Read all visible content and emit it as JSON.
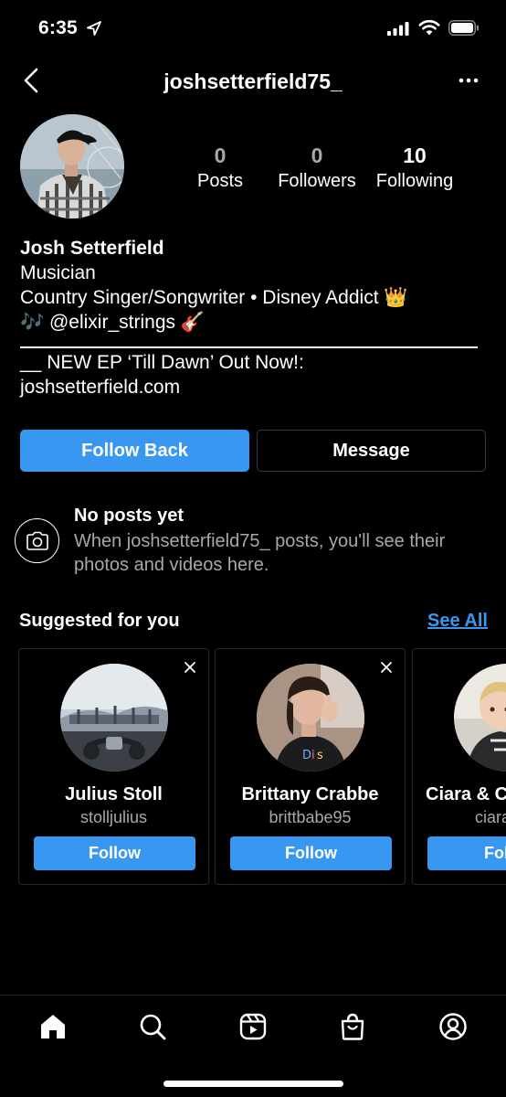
{
  "status_bar": {
    "time": "6:35"
  },
  "header": {
    "username": "joshsetterfield75_"
  },
  "profile": {
    "stats": [
      {
        "number": "0",
        "label": "Posts"
      },
      {
        "number": "0",
        "label": "Followers"
      },
      {
        "number": "10",
        "label": "Following"
      }
    ],
    "name": "Josh Setterfield",
    "category": "Musician",
    "bio_lines": [
      "Country Singer/Songwriter • Disney Addict 👑",
      "🎶 @elixir_strings 🎸",
      "__ NEW EP ‘Till Dawn’ Out Now!:",
      "joshsetterfield.com"
    ]
  },
  "actions": {
    "follow_back_label": "Follow Back",
    "message_label": "Message"
  },
  "no_posts": {
    "title": "No posts yet",
    "text": "When joshsetterfield75_ posts, you'll see their photos and videos here."
  },
  "suggested": {
    "title": "Suggested for you",
    "see_all_label": "See All",
    "cards": [
      {
        "name": "Julius Stoll",
        "handle": "stolljulius",
        "follow_label": "Follow"
      },
      {
        "name": "Brittany Crabbe",
        "handle": "brittbabe95",
        "follow_label": "Follow"
      },
      {
        "name": "Ciara & C",
        "handle": "ciarax",
        "follow_label": "Fol"
      }
    ]
  },
  "nav": {
    "items": [
      "home-icon",
      "search-icon",
      "reels-icon",
      "shop-icon",
      "profile-icon"
    ]
  },
  "colors": {
    "accent": "#3897f0",
    "background": "#000000",
    "secondary_text": "#a8a8a8"
  }
}
